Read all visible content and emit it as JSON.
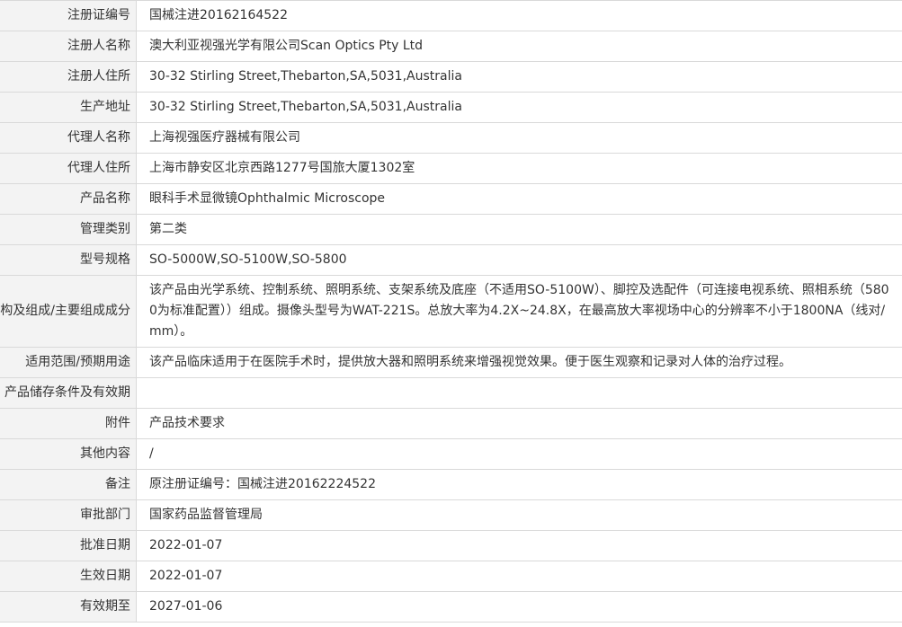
{
  "rows": [
    {
      "label": "注册证编号",
      "value": "国械注进20162164522"
    },
    {
      "label": "注册人名称",
      "value": "澳大利亚视强光学有限公司Scan Optics Pty Ltd"
    },
    {
      "label": "注册人住所",
      "value": "30-32 Stirling Street,Thebarton,SA,5031,Australia"
    },
    {
      "label": "生产地址",
      "value": "30-32 Stirling Street,Thebarton,SA,5031,Australia"
    },
    {
      "label": "代理人名称",
      "value": "上海视强医疗器械有限公司"
    },
    {
      "label": "代理人住所",
      "value": "上海市静安区北京西路1277号国旅大厦1302室"
    },
    {
      "label": "产品名称",
      "value": "眼科手术显微镜Ophthalmic Microscope"
    },
    {
      "label": "管理类别",
      "value": "第二类"
    },
    {
      "label": "型号规格",
      "value": "SO-5000W,SO-5100W,SO-5800"
    },
    {
      "label": "结构及组成/主要组成成分",
      "value": "该产品由光学系统、控制系统、照明系统、支架系统及底座（不适用SO-5100W）、脚控及选配件（可连接电视系统、照相系统（5800为标准配置））组成。摄像头型号为WAT-221S。总放大率为4.2X~24.8X，在最高放大率视场中心的分辨率不小于1800NA（线对/mm）。"
    },
    {
      "label": "适用范围/预期用途",
      "value": "该产品临床适用于在医院手术时，提供放大器和照明系统来增强视觉效果。便于医生观察和记录对人体的治疗过程。"
    },
    {
      "label": "产品储存条件及有效期",
      "value": ""
    },
    {
      "label": "附件",
      "value": "产品技术要求"
    },
    {
      "label": "其他内容",
      "value": "/"
    },
    {
      "label": "备注",
      "value": "原注册证编号：国械注进20162224522"
    },
    {
      "label": "审批部门",
      "value": "国家药品监督管理局"
    },
    {
      "label": "批准日期",
      "value": "2022-01-07"
    },
    {
      "label": "生效日期",
      "value": "2022-01-07"
    },
    {
      "label": "有效期至",
      "value": "2027-01-06"
    }
  ]
}
